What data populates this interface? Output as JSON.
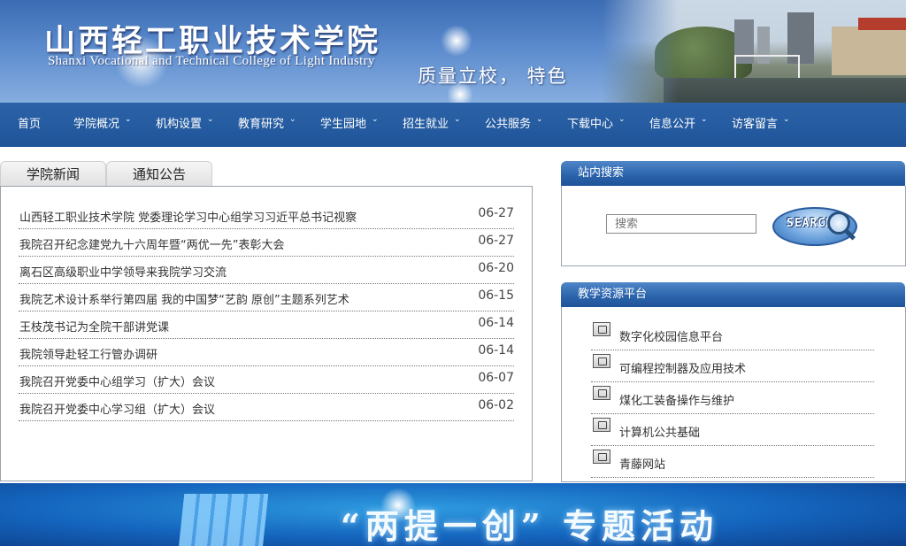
{
  "header": {
    "name_cn": "山西轻工职业技术学院",
    "name_en": "Shanxi Vocational and Technical College of Light Industry",
    "slogan": "质量立校， 特色"
  },
  "nav": {
    "items": [
      {
        "label": "首页",
        "has_dropdown": false
      },
      {
        "label": "学院概况",
        "has_dropdown": true
      },
      {
        "label": "机构设置",
        "has_dropdown": true
      },
      {
        "label": "教育研究",
        "has_dropdown": true
      },
      {
        "label": "学生园地",
        "has_dropdown": true
      },
      {
        "label": "招生就业",
        "has_dropdown": true
      },
      {
        "label": "公共服务",
        "has_dropdown": true
      },
      {
        "label": "下载中心",
        "has_dropdown": true
      },
      {
        "label": "信息公开",
        "has_dropdown": true
      },
      {
        "label": "访客留言",
        "has_dropdown": true
      }
    ]
  },
  "news": {
    "tabs": [
      "学院新闻",
      "通知公告"
    ],
    "items": [
      {
        "title": "山西轻工职业技术学院 党委理论学习中心组学习习近平总书记视察",
        "date": "06-27"
      },
      {
        "title": "我院召开纪念建党九十六周年暨“两优一先”表彰大会",
        "date": "06-27"
      },
      {
        "title": "离石区高级职业中学领导来我院学习交流",
        "date": "06-20"
      },
      {
        "title": "我院艺术设计系举行第四届 我的中国梦“艺韵 原创”主题系列艺术",
        "date": "06-15"
      },
      {
        "title": "王枝茂书记为全院干部讲党课",
        "date": "06-14"
      },
      {
        "title": "我院领导赴轻工行管办调研",
        "date": "06-14"
      },
      {
        "title": "我院召开党委中心组学习（扩大）会议",
        "date": "06-07"
      },
      {
        "title": "我院召开党委中心学习组（扩大）会议",
        "date": "06-02"
      }
    ]
  },
  "search_panel": {
    "title": "站内搜索",
    "placeholder": "搜索",
    "button_label": "SEARCH"
  },
  "resources": {
    "title": "教学资源平台",
    "items": [
      {
        "label": "数字化校园信息平台",
        "icon": "monitor-icon"
      },
      {
        "label": "可编程控制器及应用技术",
        "icon": "document-icon"
      },
      {
        "label": "煤化工装备操作与维护",
        "icon": "tool-icon"
      },
      {
        "label": "计算机公共基础",
        "icon": "tool-icon"
      },
      {
        "label": "青藤网站",
        "icon": "tool-icon"
      }
    ]
  },
  "bottom_banner": {
    "title": "“两提一创” 专题活动"
  }
}
